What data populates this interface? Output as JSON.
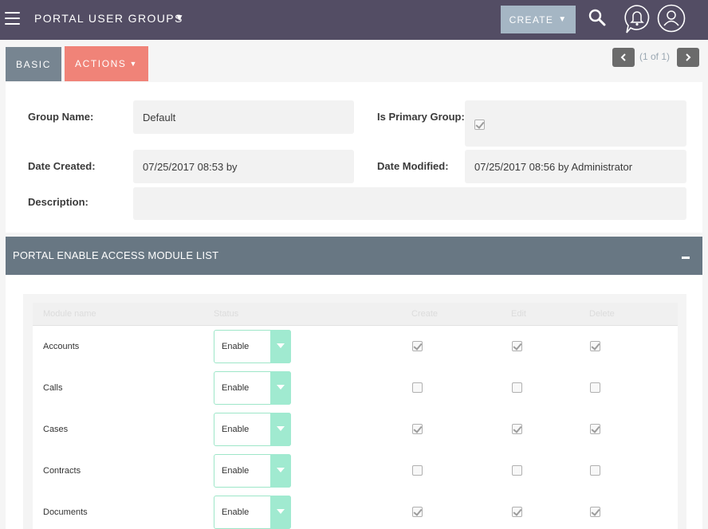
{
  "nav": {
    "title": "PORTAL USER GROUPS",
    "title_caret": "▼",
    "create_label": "CREATE",
    "create_caret": "▼"
  },
  "tabs": {
    "basic": "BASIC",
    "actions": "ACTIONS",
    "actions_caret": "▼"
  },
  "pagination": {
    "info": "(1 of 1)"
  },
  "details": {
    "group_name_label": "Group Name:",
    "group_name_value": "Default",
    "is_primary_label": "Is Primary Group:",
    "is_primary_checked": true,
    "date_created_label": "Date Created:",
    "date_created_value": "07/25/2017 08:53 by",
    "date_modified_label": "Date Modified:",
    "date_modified_value": "07/25/2017 08:56 by Administrator",
    "description_label": "Description:",
    "description_value": ""
  },
  "module_list": {
    "title": "PORTAL ENABLE ACCESS MODULE LIST",
    "columns": [
      "Module name",
      "Status",
      "Create",
      "Edit",
      "Delete"
    ],
    "rows": [
      {
        "name": "Accounts",
        "status": "Enable",
        "create": true,
        "edit": true,
        "delete": true
      },
      {
        "name": "Calls",
        "status": "Enable",
        "create": false,
        "edit": false,
        "delete": false
      },
      {
        "name": "Cases",
        "status": "Enable",
        "create": true,
        "edit": true,
        "delete": true
      },
      {
        "name": "Contracts",
        "status": "Enable",
        "create": false,
        "edit": false,
        "delete": false
      },
      {
        "name": "Documents",
        "status": "Enable",
        "create": true,
        "edit": true,
        "delete": true
      }
    ]
  },
  "colors": {
    "nav_bg": "#534d64",
    "basic_tab": "#778591",
    "actions_tab": "#f08378",
    "section_header": "#687783",
    "select_accent": "#a0ead0"
  },
  "icons": [
    "hamburger-icon",
    "search-icon",
    "bell-icon",
    "user-icon",
    "chevron-left-icon",
    "chevron-right-icon",
    "minus-icon"
  ]
}
